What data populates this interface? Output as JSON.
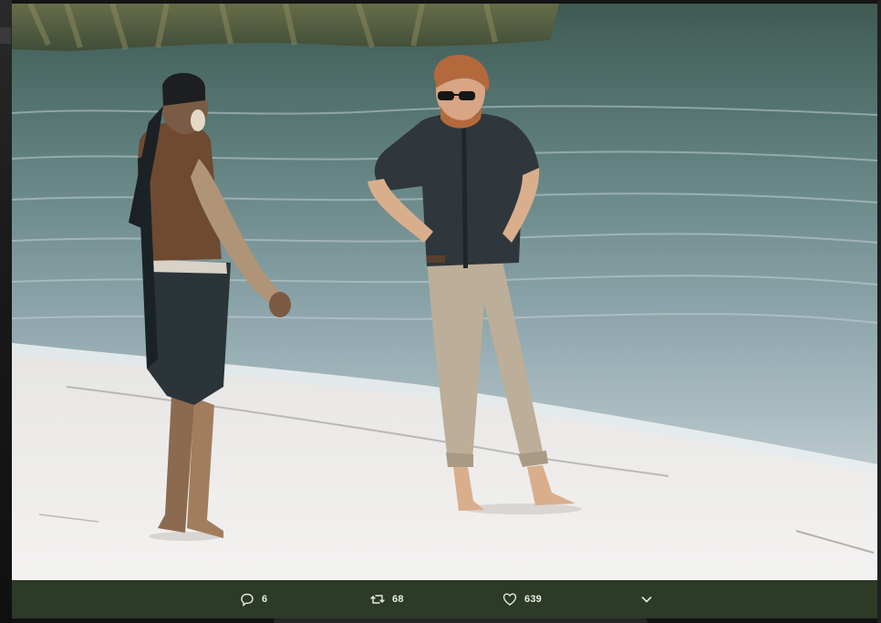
{
  "tweet": {
    "photo": {
      "icon": "photo"
    },
    "actions": {
      "reply": {
        "icon": "reply-icon",
        "count": "6"
      },
      "retweet": {
        "icon": "retweet-icon",
        "count": "68"
      },
      "like": {
        "icon": "heart-icon",
        "count": "639"
      },
      "more": {
        "icon": "chevron-down-icon"
      }
    }
  },
  "colors": {
    "action_bar": "#2c3a26",
    "action_text": "#e8ece4",
    "backdrop": "#151515"
  }
}
